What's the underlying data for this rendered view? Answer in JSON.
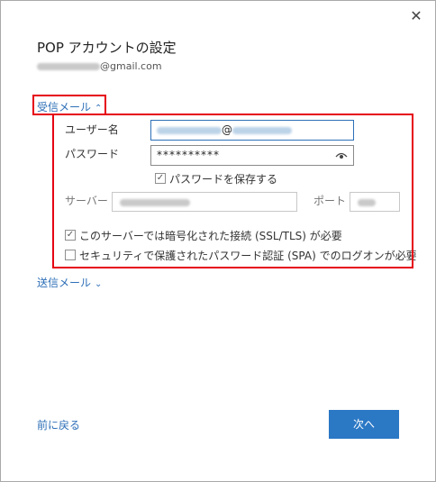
{
  "dialog": {
    "title": "POP アカウントの設定",
    "email_domain": "@gmail.com",
    "close_glyph": "✕"
  },
  "incoming": {
    "header": "受信メール",
    "chevron": "⌃",
    "username_label": "ユーザー名",
    "username_domain": "@",
    "password_label": "パスワード",
    "password_value": "**********",
    "save_password_label": "パスワードを保存する",
    "server_label": "サーバー",
    "port_label": "ポート",
    "ssl_label": "このサーバーでは暗号化された接続 (SSL/TLS) が必要",
    "spa_label": "セキュリティで保護されたパスワード認証 (SPA) でのログオンが必要",
    "save_password_checked": true,
    "ssl_checked": true,
    "spa_checked": false
  },
  "outgoing": {
    "header": "送信メール",
    "chevron": "⌄"
  },
  "footer": {
    "back_label": "前に戻る",
    "next_label": "次へ"
  },
  "colors": {
    "accent": "#2b78c5",
    "link": "#2e6fb7",
    "highlight": "#e60012"
  },
  "icons": {
    "eye": "eye-icon",
    "check": "check-icon"
  }
}
